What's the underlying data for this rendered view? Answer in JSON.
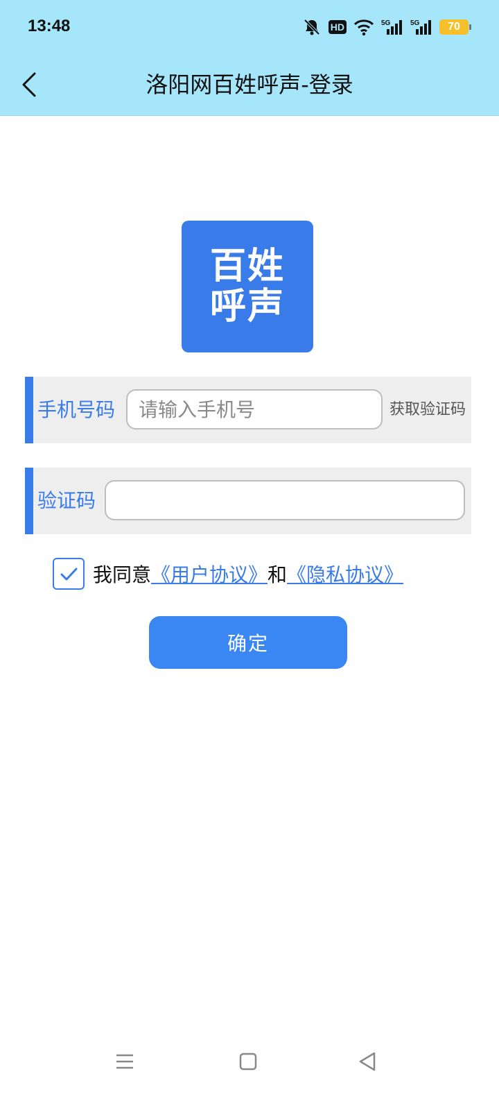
{
  "status_bar": {
    "time": "13:48",
    "hd_label": "HD",
    "battery_level": "70",
    "icons": [
      "bell-muted-icon",
      "hd-icon",
      "wifi-icon",
      "signal-5g-icon",
      "signal-5g-icon",
      "battery-icon"
    ]
  },
  "header": {
    "title": "洛阳网百姓呼声-登录",
    "back_icon": "chevron-left-icon"
  },
  "logo": {
    "line1": "百姓",
    "line2": "呼声"
  },
  "form": {
    "phone_label": "手机号码",
    "phone_placeholder": "请输入手机号",
    "phone_value": "",
    "get_code_label": "获取验证码",
    "code_label": "验证码",
    "code_value": ""
  },
  "agreement": {
    "checked": true,
    "prefix": "我同意",
    "user_agreement": "《用户协议》",
    "conjunction": "和",
    "privacy_agreement": "《隐私协议》"
  },
  "submit_label": "确定",
  "colors": {
    "header_bg": "#a6e6fb",
    "accent": "#3a7bea",
    "button": "#3a86f2"
  }
}
